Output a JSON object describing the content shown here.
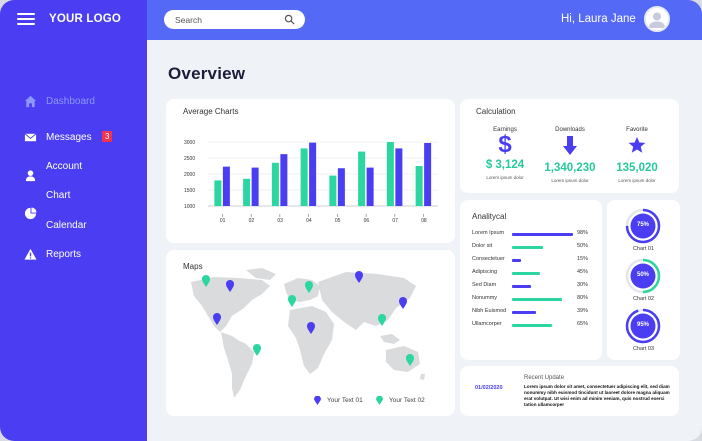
{
  "brand": {
    "logo": "YOUR LOGO"
  },
  "sidebar": {
    "items": [
      {
        "label": "Dashboard",
        "icon": "home-icon",
        "active": true
      },
      {
        "label": "Messages",
        "icon": "mail-icon",
        "badge": "3"
      },
      {
        "label": "Account",
        "icon": "user-icon"
      },
      {
        "label": "Chart",
        "icon": "pie-chart-icon"
      },
      {
        "label": "Calendar",
        "icon": "calendar-icon"
      },
      {
        "label": "Reports",
        "icon": "warning-icon"
      }
    ]
  },
  "header": {
    "search_placeholder": "Search",
    "greeting": "Hi, Laura Jane"
  },
  "page_title": "Overview",
  "average_charts": {
    "title": "Average Charts",
    "chart_data": {
      "type": "bar",
      "categories": [
        "01",
        "02",
        "03",
        "04",
        "05",
        "06",
        "07",
        "08"
      ],
      "yticks": [
        "3000",
        "2500",
        "2000",
        "1500",
        "1000"
      ],
      "ylim": [
        1000,
        3000
      ],
      "series": [
        {
          "color": "#2bd6a1",
          "values": [
            1800,
            1850,
            2350,
            2800,
            1950,
            2700,
            3000,
            2250
          ]
        },
        {
          "color": "#4a3df2",
          "values": [
            2230,
            2200,
            2620,
            2980,
            2180,
            2200,
            2800,
            2970
          ]
        }
      ],
      "grid": true
    }
  },
  "maps": {
    "title": "Maps",
    "legend": [
      {
        "label": "Your Text 01",
        "color": "#4a3df2"
      },
      {
        "label": "Your Text 02",
        "color": "#2bd6a1"
      }
    ]
  },
  "calculation": {
    "title": "Calculation",
    "items": [
      {
        "label": "Earnings",
        "value": "$ 3,124",
        "sub": "Lorem ipsum dolor",
        "icon": "dollar-icon"
      },
      {
        "label": "Downloads",
        "value": "1,340,230",
        "sub": "Lorem ipsum dolor",
        "icon": "download-arrow-icon"
      },
      {
        "label": "Favorite",
        "value": "135,020",
        "sub": "Lorem ipsum dolor",
        "icon": "star-icon"
      }
    ]
  },
  "analytical": {
    "title": "Analitycal",
    "rows": [
      {
        "label": "Lorem Ipsum",
        "value": "98%",
        "fraction": 0.98,
        "color": "#4a3df2"
      },
      {
        "label": "Dolor sit",
        "value": "50%",
        "fraction": 0.5,
        "color": "#2bd6a1"
      },
      {
        "label": "Consectetuer",
        "value": "15%",
        "fraction": 0.15,
        "color": "#4a3df2"
      },
      {
        "label": "Adipiscing",
        "value": "45%",
        "fraction": 0.45,
        "color": "#2bd6a1"
      },
      {
        "label": "Sed Diam",
        "value": "30%",
        "fraction": 0.3,
        "color": "#4a3df2"
      },
      {
        "label": "Nonummy",
        "value": "80%",
        "fraction": 0.8,
        "color": "#2bd6a1"
      },
      {
        "label": "Nibh Euismod",
        "value": "39%",
        "fraction": 0.39,
        "color": "#4a3df2"
      },
      {
        "label": "Ullamcorper",
        "value": "65%",
        "fraction": 0.65,
        "color": "#2bd6a1"
      }
    ]
  },
  "donuts": [
    {
      "value": "75%",
      "fraction": 0.75,
      "label": "Chart 01",
      "ring": "#4a3df2",
      "fill": "#4a3df2"
    },
    {
      "value": "50%",
      "fraction": 0.5,
      "label": "Chart 02",
      "ring": "#2bd6a1",
      "fill": "#4a3df2"
    },
    {
      "value": "95%",
      "fraction": 0.95,
      "label": "Chart 03",
      "ring": "#4a3df2",
      "fill": "#4a3df2"
    }
  ],
  "recent_update": {
    "title": "Recent Update",
    "date": "01/02/2020",
    "text": "Lorem ipsum dolor sit amet, consectetuer adipiscing elit, sed diam nonummy nibh euismod tincidunt ut laoreet dolore magna aliquam erat volutpat. Ut wisi enim ad minim veniam, quis nostrud exerci tation ullamcorper"
  }
}
